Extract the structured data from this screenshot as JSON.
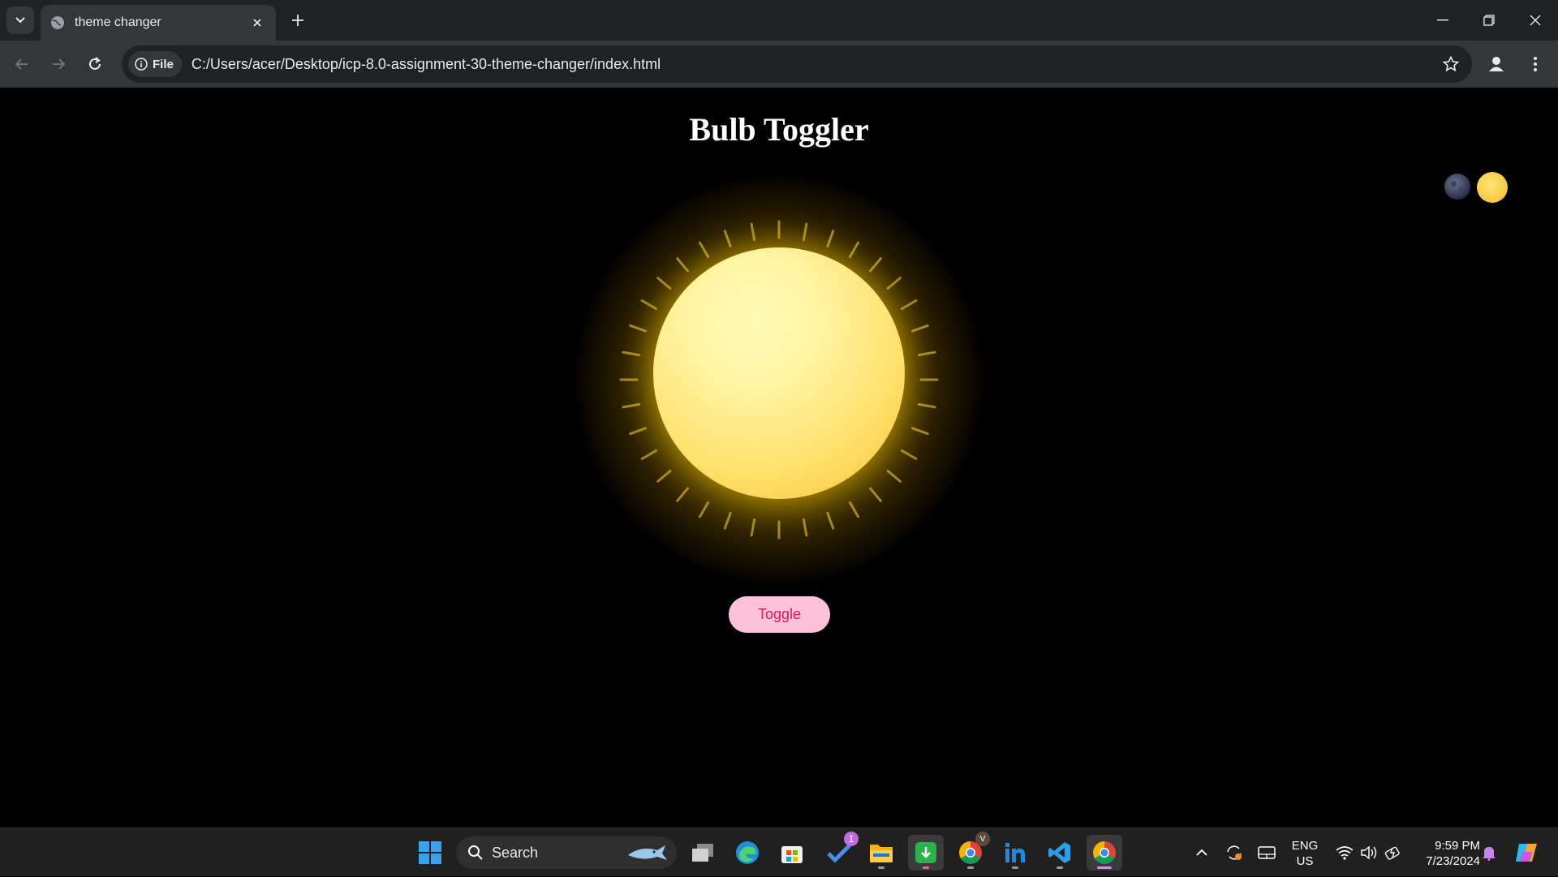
{
  "browser": {
    "tab_title": "theme changer",
    "site_chip_label": "File",
    "url": "C:/Users/acer/Desktop/icp-8.0-assignment-30-theme-changer/index.html"
  },
  "page": {
    "title": "Bulb Toggler",
    "toggle_label": "Toggle",
    "bulb_state": "on",
    "colors": {
      "background": "#000000",
      "bulb": "#ffe06b",
      "toggle_bg": "#ffc1d9",
      "toggle_text": "#d6185f"
    }
  },
  "taskbar": {
    "search_label": "Search",
    "todo_badge": "1",
    "chrome_profile_badge": "V",
    "language": "ENG",
    "region": "US",
    "time": "9:59 PM",
    "date": "7/23/2024"
  },
  "icons": [
    "tab-search-icon",
    "globe-icon",
    "close-icon",
    "plus-icon",
    "minimize-icon",
    "restore-icon",
    "back-icon",
    "forward-icon",
    "reload-icon",
    "info-icon",
    "star-icon",
    "profile-icon",
    "menu-icon",
    "moon-icon",
    "sun-icon",
    "windows-start-icon",
    "search-icon",
    "task-view-icon",
    "edge-icon",
    "store-icon",
    "todo-icon",
    "file-explorer-icon",
    "download-icon",
    "chrome-icon",
    "linkedin-icon",
    "vscode-icon",
    "chevron-up-icon",
    "sync-icon",
    "tablet-icon",
    "wifi-icon",
    "volume-icon",
    "battery-icon",
    "bell-icon",
    "copilot-icon"
  ]
}
